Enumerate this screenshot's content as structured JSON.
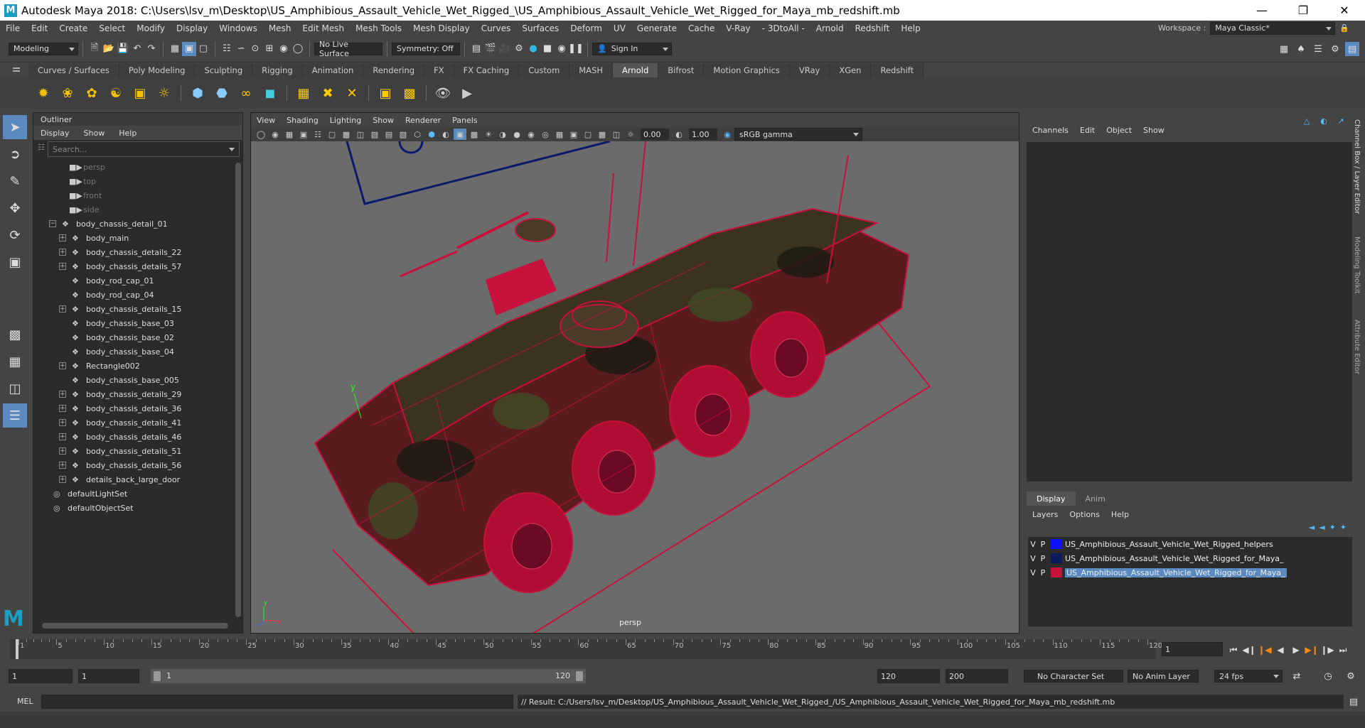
{
  "window": {
    "title": "Autodesk Maya 2018: C:\\Users\\lsv_m\\Desktop\\US_Amphibious_Assault_Vehicle_Wet_Rigged_\\US_Amphibious_Assault_Vehicle_Wet_Rigged_for_Maya_mb_redshift.mb",
    "logo": "M"
  },
  "menubar": {
    "items": [
      "File",
      "Edit",
      "Create",
      "Select",
      "Modify",
      "Display",
      "Windows",
      "Mesh",
      "Edit Mesh",
      "Mesh Tools",
      "Mesh Display",
      "Curves",
      "Surfaces",
      "Deform",
      "UV",
      "Generate",
      "Cache",
      "V-Ray",
      "- 3DtoAll -",
      "Arnold",
      "Redshift",
      "Help"
    ],
    "workspace_label": "Workspace :",
    "workspace_value": "Maya Classic*"
  },
  "statusline": {
    "mode": "Modeling",
    "live_surface": "No Live Surface",
    "symmetry": "Symmetry: Off",
    "sign_in": "Sign In"
  },
  "shelf": {
    "tabs": [
      "Curves / Surfaces",
      "Poly Modeling",
      "Sculpting",
      "Rigging",
      "Animation",
      "Rendering",
      "FX",
      "FX Caching",
      "Custom",
      "MASH",
      "Arnold",
      "Bifrost",
      "Motion Graphics",
      "VRay",
      "XGen",
      "Redshift"
    ],
    "active_tab": "Arnold"
  },
  "outliner": {
    "title": "Outliner",
    "menu": [
      "Display",
      "Show",
      "Help"
    ],
    "search_placeholder": "Search...",
    "cameras": [
      "persp",
      "top",
      "front",
      "side"
    ],
    "root": "body_chassis_detail_01",
    "children": [
      {
        "name": "body_main",
        "expandable": true
      },
      {
        "name": "body_chassis_details_22",
        "expandable": true
      },
      {
        "name": "body_chassis_details_57",
        "expandable": true
      },
      {
        "name": "body_rod_cap_01",
        "expandable": false
      },
      {
        "name": "body_rod_cap_04",
        "expandable": false
      },
      {
        "name": "body_chassis_details_15",
        "expandable": true
      },
      {
        "name": "body_chassis_base_03",
        "expandable": false
      },
      {
        "name": "body_chassis_base_02",
        "expandable": false
      },
      {
        "name": "body_chassis_base_04",
        "expandable": false
      },
      {
        "name": "Rectangle002",
        "expandable": true
      },
      {
        "name": "body_chassis_base_005",
        "expandable": false
      },
      {
        "name": "body_chassis_details_29",
        "expandable": true
      },
      {
        "name": "body_chassis_details_36",
        "expandable": true
      },
      {
        "name": "body_chassis_details_41",
        "expandable": true
      },
      {
        "name": "body_chassis_details_46",
        "expandable": true
      },
      {
        "name": "body_chassis_details_51",
        "expandable": true
      },
      {
        "name": "body_chassis_details_56",
        "expandable": true
      },
      {
        "name": "details_back_large_door",
        "expandable": true
      }
    ],
    "sets": [
      "defaultLightSet",
      "defaultObjectSet"
    ]
  },
  "viewport": {
    "menu": [
      "View",
      "Shading",
      "Lighting",
      "Show",
      "Renderer",
      "Panels"
    ],
    "exposure": "0.00",
    "gamma": "1.00",
    "color_space": "sRGB gamma",
    "camera": "persp",
    "wire_color": "#c8103c"
  },
  "channelbox": {
    "menu": [
      "Channels",
      "Edit",
      "Object",
      "Show"
    ],
    "layer_tabs": [
      "Display",
      "Anim"
    ],
    "active_layer_tab": "Display",
    "layer_menu": [
      "Layers",
      "Options",
      "Help"
    ],
    "layers": [
      {
        "v": "V",
        "p": "P",
        "color": "#1010ff",
        "name": "US_Amphibious_Assault_Vehicle_Wet_Rigged_helpers",
        "selected": false
      },
      {
        "v": "V",
        "p": "P",
        "color": "#0a1a5a",
        "name": "US_Amphibious_Assault_Vehicle_Wet_Rigged_for_Maya_",
        "selected": false
      },
      {
        "v": "V",
        "p": "P",
        "color": "#c8103c",
        "name": "US_Amphibious_Assault_Vehicle_Wet_Rigged_for_Maya_",
        "selected": true
      }
    ]
  },
  "sidetabs": [
    "Channel Box / Layer Editor",
    "Modeling Toolkit",
    "Attribute Editor"
  ],
  "timeslider": {
    "ticks": [
      1,
      5,
      10,
      15,
      20,
      25,
      30,
      35,
      40,
      45,
      50,
      55,
      60,
      65,
      70,
      75,
      80,
      85,
      90,
      95,
      100,
      105,
      110,
      115,
      120
    ],
    "current_frame": "1"
  },
  "rangeslider": {
    "start": "1",
    "playback_start": "1",
    "range_inner_start": "1",
    "range_inner_end": "120",
    "playback_end": "120",
    "end": "200",
    "character_set": "No Character Set",
    "anim_layer": "No Anim Layer",
    "fps": "24 fps"
  },
  "cmdline": {
    "label": "MEL",
    "result": "// Result: C:/Users/lsv_m/Desktop/US_Amphibious_Assault_Vehicle_Wet_Rigged_/US_Amphibious_Assault_Vehicle_Wet_Rigged_for_Maya_mb_redshift.mb"
  }
}
